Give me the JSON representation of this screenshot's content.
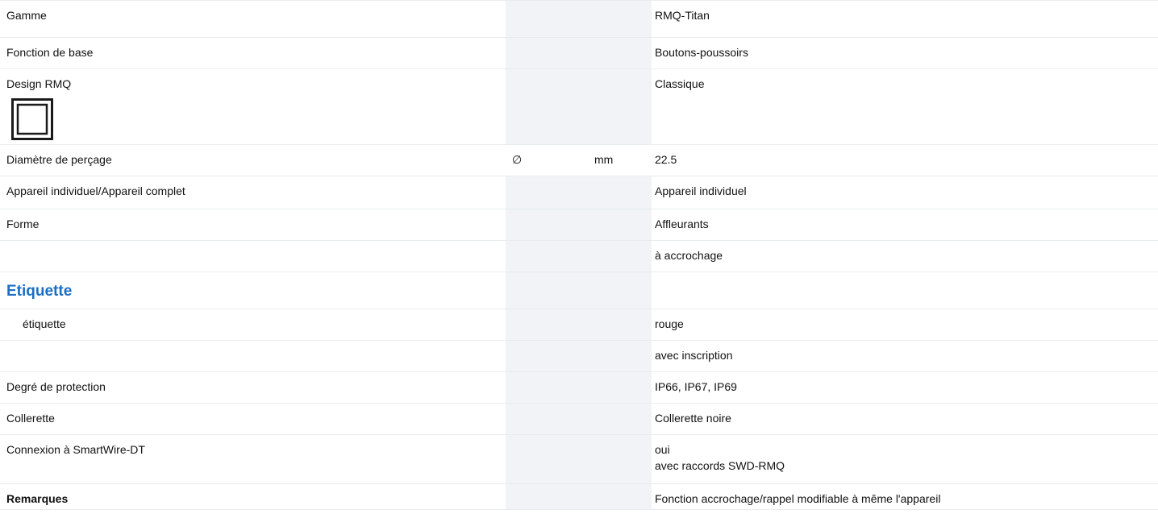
{
  "rows": [
    {
      "label": "Gamme",
      "symbol": "",
      "unit": "",
      "value": "RMQ-Titan"
    },
    {
      "label": "Fonction de base",
      "symbol": "",
      "unit": "",
      "value": "Boutons-poussoirs"
    },
    {
      "label": "Design RMQ",
      "symbol": "",
      "unit": "",
      "value": "Classique",
      "icon": "square-button-design-icon"
    },
    {
      "label": "Diamètre de perçage",
      "symbol": "∅",
      "unit": "mm",
      "value": "22.5"
    },
    {
      "label": "Appareil individuel/Appareil complet",
      "symbol": "",
      "unit": "",
      "value": "Appareil individuel"
    },
    {
      "label": "Forme",
      "symbol": "",
      "unit": "",
      "value": "Affleurants"
    },
    {
      "label": "",
      "symbol": "",
      "unit": "",
      "value": "à accrochage"
    },
    {
      "label": "Etiquette",
      "symbol": "",
      "unit": "",
      "value": "",
      "section_heading": true
    },
    {
      "label": "étiquette",
      "symbol": "",
      "unit": "",
      "value": "rouge"
    },
    {
      "label": "",
      "symbol": "",
      "unit": "",
      "value": "avec inscription"
    },
    {
      "label": "Degré de protection",
      "symbol": "",
      "unit": "",
      "value": "IP66, IP67, IP69"
    },
    {
      "label": "Collerette",
      "symbol": "",
      "unit": "",
      "value": "Collerette noire"
    },
    {
      "label": "Connexion à SmartWire-DT",
      "symbol": "",
      "unit": "",
      "value": "oui",
      "value_line2": "avec raccords SWD-RMQ"
    },
    {
      "label": "Remarques",
      "symbol": "",
      "unit": "",
      "value": "Fonction accrochage/rappel modifiable à même l'appareil"
    }
  ],
  "colors": {
    "heading": "#1a6fc4",
    "shaded_column": "#f1f3f7",
    "row_border": "#e9ecef"
  }
}
